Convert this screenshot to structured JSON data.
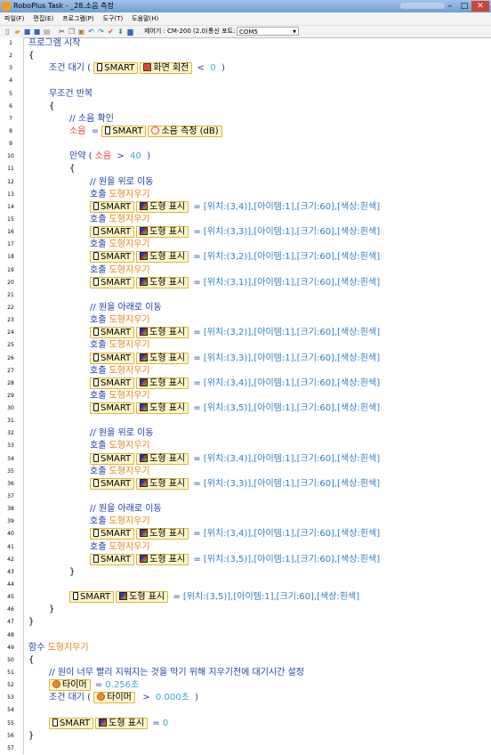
{
  "window": {
    "title": "RoboPlus Task - _28.소음 측정"
  },
  "menubar": [
    "파일(F)",
    "편집(E)",
    "프로그램(P)",
    "도구(T)",
    "도움말(H)"
  ],
  "toolbar": {
    "controller_label": "제어기 :",
    "controller_value": "CM-200 (2.0)",
    "port_label": "통신 포트:",
    "port_value": "COM5"
  },
  "code": [
    [
      {
        "t": "프로그램 시작",
        "c": "kw"
      }
    ],
    [
      {
        "t": "{"
      }
    ],
    [
      {
        "t": "조건 대기 ( ",
        "c": "kw"
      },
      {
        "t": "SMART",
        "sm": true,
        "icon": "phone-icon",
        "pair": "화면 회전",
        "pairIcon": "rotate-icon"
      },
      {
        "t": " <  ",
        "c": "kw"
      },
      {
        "t": "0",
        "c": "num"
      },
      {
        "t": "  )",
        "c": "kw"
      }
    ],
    [],
    [
      {
        "t": "무조건 반복",
        "c": "kw"
      }
    ],
    [
      {
        "t": "{"
      }
    ],
    [
      {
        "t": "// 소음 확인",
        "c": "cmt"
      }
    ],
    [
      {
        "t": "소음",
        "c": "red"
      },
      {
        "t": "  = ",
        "c": "kw"
      },
      {
        "t": "SMART",
        "sm": true,
        "icon": "phone-icon",
        "pair": "소음 측정 (dB)",
        "pairIcon": "sound-icon"
      }
    ],
    [],
    [
      {
        "t": "만약 ( ",
        "c": "kw"
      },
      {
        "t": "소음",
        "c": "red"
      },
      {
        "t": "  >  ",
        "c": "kw"
      },
      {
        "t": "40",
        "c": "num"
      },
      {
        "t": "  )",
        "c": "kw"
      }
    ],
    [
      {
        "t": "{"
      }
    ],
    [
      {
        "t": "// 원을 위로 이동",
        "c": "cmt"
      }
    ],
    [
      {
        "t": "호출 ",
        "c": "kw"
      },
      {
        "t": "도형지우기",
        "c": "fn"
      }
    ],
    [
      {
        "t": "SMART",
        "sm": true,
        "icon": "phone-icon",
        "pair": "도형 표시",
        "pairIcon": "shape-icon"
      },
      {
        "t": " = ",
        "c": "kw"
      },
      {
        "t": "[위치:(3,4)],[아이템:1],[크기:60],[색상:흰색]",
        "c": "prm"
      }
    ],
    [
      {
        "t": "호출 ",
        "c": "kw"
      },
      {
        "t": "도형지우기",
        "c": "fn"
      }
    ],
    [
      {
        "t": "SMART",
        "sm": true,
        "icon": "phone-icon",
        "pair": "도형 표시",
        "pairIcon": "shape-icon"
      },
      {
        "t": " = ",
        "c": "kw"
      },
      {
        "t": "[위치:(3,3)],[아이템:1],[크기:60],[색상:흰색]",
        "c": "prm"
      }
    ],
    [
      {
        "t": "호출 ",
        "c": "kw"
      },
      {
        "t": "도형지우기",
        "c": "fn"
      }
    ],
    [
      {
        "t": "SMART",
        "sm": true,
        "icon": "phone-icon",
        "pair": "도형 표시",
        "pairIcon": "shape-icon"
      },
      {
        "t": " = ",
        "c": "kw"
      },
      {
        "t": "[위치:(3,2)],[아이템:1],[크기:60],[색상:흰색]",
        "c": "prm"
      }
    ],
    [
      {
        "t": "호출 ",
        "c": "kw"
      },
      {
        "t": "도형지우기",
        "c": "fn"
      }
    ],
    [
      {
        "t": "SMART",
        "sm": true,
        "icon": "phone-icon",
        "pair": "도형 표시",
        "pairIcon": "shape-icon"
      },
      {
        "t": " = ",
        "c": "kw"
      },
      {
        "t": "[위치:(3,1)],[아이템:1],[크기:60],[색상:흰색]",
        "c": "prm"
      }
    ],
    [],
    [
      {
        "t": "// 원을 아래로 이동",
        "c": "cmt"
      }
    ],
    [
      {
        "t": "호출 ",
        "c": "kw"
      },
      {
        "t": "도형지우기",
        "c": "fn"
      }
    ],
    [
      {
        "t": "SMART",
        "sm": true,
        "icon": "phone-icon",
        "pair": "도형 표시",
        "pairIcon": "shape-icon"
      },
      {
        "t": " = ",
        "c": "kw"
      },
      {
        "t": "[위치:(3,2)],[아이템:1],[크기:60],[색상:흰색]",
        "c": "prm"
      }
    ],
    [
      {
        "t": "호출 ",
        "c": "kw"
      },
      {
        "t": "도형지우기",
        "c": "fn"
      }
    ],
    [
      {
        "t": "SMART",
        "sm": true,
        "icon": "phone-icon",
        "pair": "도형 표시",
        "pairIcon": "shape-icon"
      },
      {
        "t": " = ",
        "c": "kw"
      },
      {
        "t": "[위치:(3,3)],[아이템:1],[크기:60],[색상:흰색]",
        "c": "prm"
      }
    ],
    [
      {
        "t": "호출 ",
        "c": "kw"
      },
      {
        "t": "도형지우기",
        "c": "fn"
      }
    ],
    [
      {
        "t": "SMART",
        "sm": true,
        "icon": "phone-icon",
        "pair": "도형 표시",
        "pairIcon": "shape-icon"
      },
      {
        "t": " = ",
        "c": "kw"
      },
      {
        "t": "[위치:(3,4)],[아이템:1],[크기:60],[색상:흰색]",
        "c": "prm"
      }
    ],
    [
      {
        "t": "호출 ",
        "c": "kw"
      },
      {
        "t": "도형지우기",
        "c": "fn"
      }
    ],
    [
      {
        "t": "SMART",
        "sm": true,
        "icon": "phone-icon",
        "pair": "도형 표시",
        "pairIcon": "shape-icon"
      },
      {
        "t": " = ",
        "c": "kw"
      },
      {
        "t": "[위치:(3,5)],[아이템:1],[크기:60],[색상:흰색]",
        "c": "prm"
      }
    ],
    [],
    [
      {
        "t": "// 원을 위로 이동",
        "c": "cmt"
      }
    ],
    [
      {
        "t": "호출 ",
        "c": "kw"
      },
      {
        "t": "도형지우기",
        "c": "fn"
      }
    ],
    [
      {
        "t": "SMART",
        "sm": true,
        "icon": "phone-icon",
        "pair": "도형 표시",
        "pairIcon": "shape-icon"
      },
      {
        "t": " = ",
        "c": "kw"
      },
      {
        "t": "[위치:(3,4)],[아이템:1],[크기:60],[색상:흰색]",
        "c": "prm"
      }
    ],
    [
      {
        "t": "호출 ",
        "c": "kw"
      },
      {
        "t": "도형지우기",
        "c": "fn"
      }
    ],
    [
      {
        "t": "SMART",
        "sm": true,
        "icon": "phone-icon",
        "pair": "도형 표시",
        "pairIcon": "shape-icon"
      },
      {
        "t": " = ",
        "c": "kw"
      },
      {
        "t": "[위치:(3,3)],[아이템:1],[크기:60],[색상:흰색]",
        "c": "prm"
      }
    ],
    [],
    [
      {
        "t": "// 원을 아래로 이동",
        "c": "cmt"
      }
    ],
    [
      {
        "t": "호출 ",
        "c": "kw"
      },
      {
        "t": "도형지우기",
        "c": "fn"
      }
    ],
    [
      {
        "t": "SMART",
        "sm": true,
        "icon": "phone-icon",
        "pair": "도형 표시",
        "pairIcon": "shape-icon"
      },
      {
        "t": " = ",
        "c": "kw"
      },
      {
        "t": "[위치:(3,4)],[아이템:1],[크기:60],[색상:흰색]",
        "c": "prm"
      }
    ],
    [
      {
        "t": "호출 ",
        "c": "kw"
      },
      {
        "t": "도형지우기",
        "c": "fn"
      }
    ],
    [
      {
        "t": "SMART",
        "sm": true,
        "icon": "phone-icon",
        "pair": "도형 표시",
        "pairIcon": "shape-icon"
      },
      {
        "t": " = ",
        "c": "kw"
      },
      {
        "t": "[위치:(3,5)],[아이템:1],[크기:60],[색상:흰색]",
        "c": "prm"
      }
    ],
    [
      {
        "t": "}"
      }
    ],
    [],
    [
      {
        "t": "SMART",
        "sm": true,
        "icon": "phone-icon",
        "pair": "도형 표시",
        "pairIcon": "shape-icon"
      },
      {
        "t": " = ",
        "c": "kw"
      },
      {
        "t": "[위치:(3,5)],[아이템:1],[크기:60],[색상:흰색]",
        "c": "prm"
      }
    ],
    [
      {
        "t": "}"
      }
    ],
    [
      {
        "t": "}"
      }
    ],
    [],
    [
      {
        "t": "함수 ",
        "c": "kw"
      },
      {
        "t": "도형지우기",
        "c": "fn"
      }
    ],
    [
      {
        "t": "{"
      }
    ],
    [
      {
        "t": "// 원이 너무 빨리 지워지는 것을 막기 위해 지우기전에 대기시간 설정",
        "c": "cmt"
      }
    ],
    [
      {
        "t": "타이머",
        "timer": true
      },
      {
        "t": " = ",
        "c": "kw"
      },
      {
        "t": "0.256초",
        "c": "num"
      }
    ],
    [
      {
        "t": "조건 대기 ( ",
        "c": "kw"
      },
      {
        "t": "타이머",
        "timer": true
      },
      {
        "t": "  >  ",
        "c": "kw"
      },
      {
        "t": "0.000초",
        "c": "num"
      },
      {
        "t": "  )",
        "c": "kw"
      }
    ],
    [],
    [
      {
        "t": "SMART",
        "sm": true,
        "icon": "phone-icon",
        "pair": "도형 표시",
        "pairIcon": "shape-icon"
      },
      {
        "t": " = ",
        "c": "kw"
      },
      {
        "t": "0",
        "c": "num"
      }
    ],
    [
      {
        "t": "}"
      }
    ],
    []
  ]
}
